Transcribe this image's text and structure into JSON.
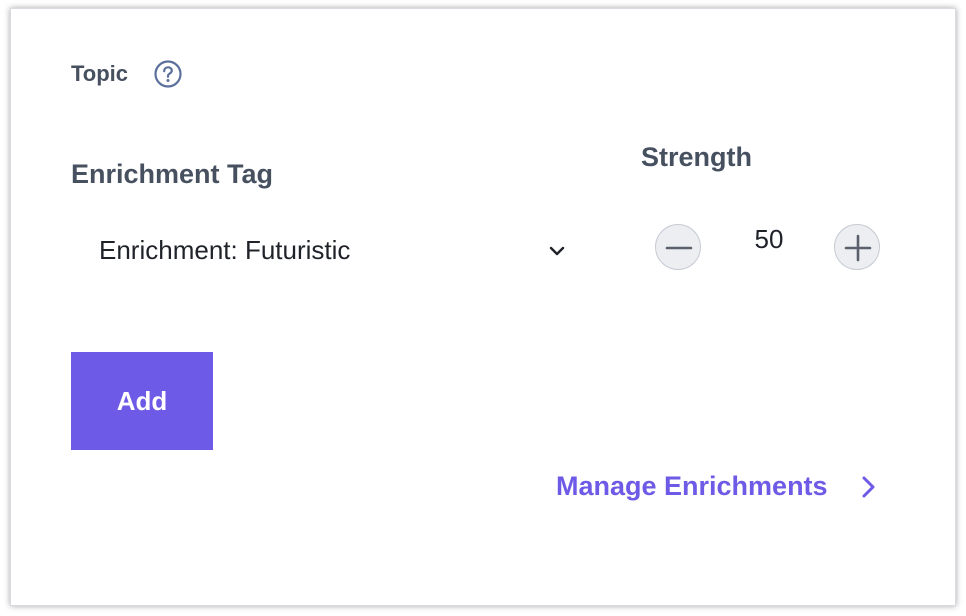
{
  "topic": {
    "label": "Topic",
    "help_icon": "question-circle-icon"
  },
  "enrichment": {
    "label": "Enrichment Tag",
    "selected": "Enrichment: Futuristic",
    "dropdown_icon": "chevron-down-icon"
  },
  "strength": {
    "label": "Strength",
    "value": "50",
    "decrement_icon": "minus-icon",
    "increment_icon": "plus-icon"
  },
  "actions": {
    "add_label": "Add",
    "manage_label": "Manage Enrichments",
    "manage_icon": "chevron-right-icon"
  },
  "colors": {
    "accent": "#6d5ae6",
    "heading": "#46505f",
    "text": "#1f2329"
  }
}
